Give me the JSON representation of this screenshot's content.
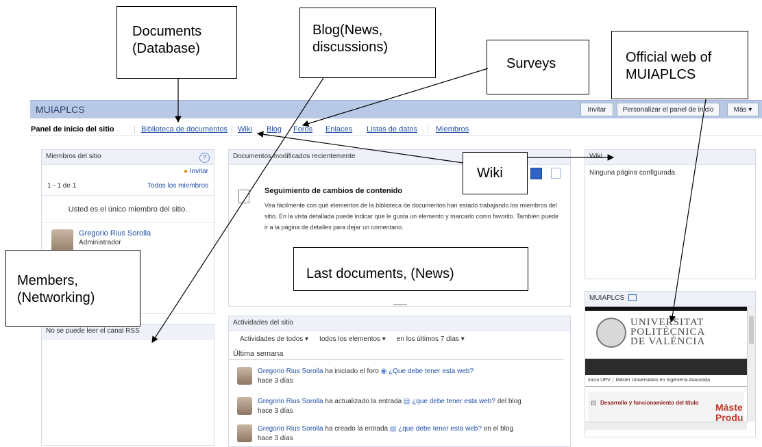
{
  "annotations": {
    "documents": "Documents (Database)",
    "blog": "Blog(News, discussions)",
    "surveys": "Surveys",
    "official_web": "Official web of MUIAPLCS",
    "wiki": "Wiki",
    "last_docs": "Last documents, (News)",
    "members": "Members, (Networking)"
  },
  "header": {
    "title": "MUIAPLCS",
    "buttons": [
      "Invitar",
      "Personalizar el panel de inicio",
      "Más ▾"
    ]
  },
  "nav": [
    "Panel de inicio del sitio",
    "Biblioteca de documentos",
    "Wiki",
    "Blog",
    "Foros",
    "Enlaces",
    "Listas de datos",
    "Miembros"
  ],
  "members_panel": {
    "title": "Miembros del sitio",
    "help": "?",
    "invite": "Invitar",
    "count": "1 - 1 de 1",
    "all_link": "Todos los miembros",
    "only_member": "Usted es el único miembro del sitio.",
    "member_name": "Gregorio Rius Sorolla",
    "member_role": "Administrador"
  },
  "rss_panel": {
    "title": "No se puede leer el canal RSS"
  },
  "docs_panel": {
    "title": "Documentos modificados recientemente",
    "heading": "Seguimiento de cambios de contenido",
    "body": "Vea fácilmente con qué elementos de la biblioteca de documentos han estado trabajando los miembros del sitio. En la vista detallada puede indicar que le gusta un elemento y marcarlo como favorito. También puede ir a la página de detalles para dejar un comentario."
  },
  "activity_panel": {
    "title": "Actividades del sitio",
    "filters": [
      "Actividades de todos ▾",
      "todos los elementos ▾",
      "en los últimos 7 días ▾"
    ],
    "week": "Última semana",
    "items": [
      {
        "user": "Gregorio Rius Sorolla",
        "action": " ha iniciado el foro ",
        "target": "¿Que debe tener esta web?",
        "suffix": "",
        "time": "hace 3 días"
      },
      {
        "user": "Gregorio Rius Sorolla",
        "action": " ha actualizado la entrada ",
        "target": "¿que debe tener esta web?",
        "suffix": " del blog",
        "time": "hace 3 días"
      },
      {
        "user": "Gregorio Rius Sorolla",
        "action": " ha creado la entrada ",
        "target": "¿que debe tener esta web?",
        "suffix": " en el blog",
        "time": "hace 3 días"
      }
    ]
  },
  "wiki_panel": {
    "title": "Wiki",
    "text": "Ninguna página configurada"
  },
  "web_panel": {
    "title": "MUIAPLCS",
    "univ_lines": [
      "UNIVERSITAT",
      "POLITÈCNICA",
      "DE VALÈNCIA"
    ],
    "breadcrumb": "Inicio UPV :: Máster Universitario en Ingeniería Avanzada",
    "menu_item": "Desarrollo y funcionamiento del título",
    "big_text": "Máste Produ"
  }
}
